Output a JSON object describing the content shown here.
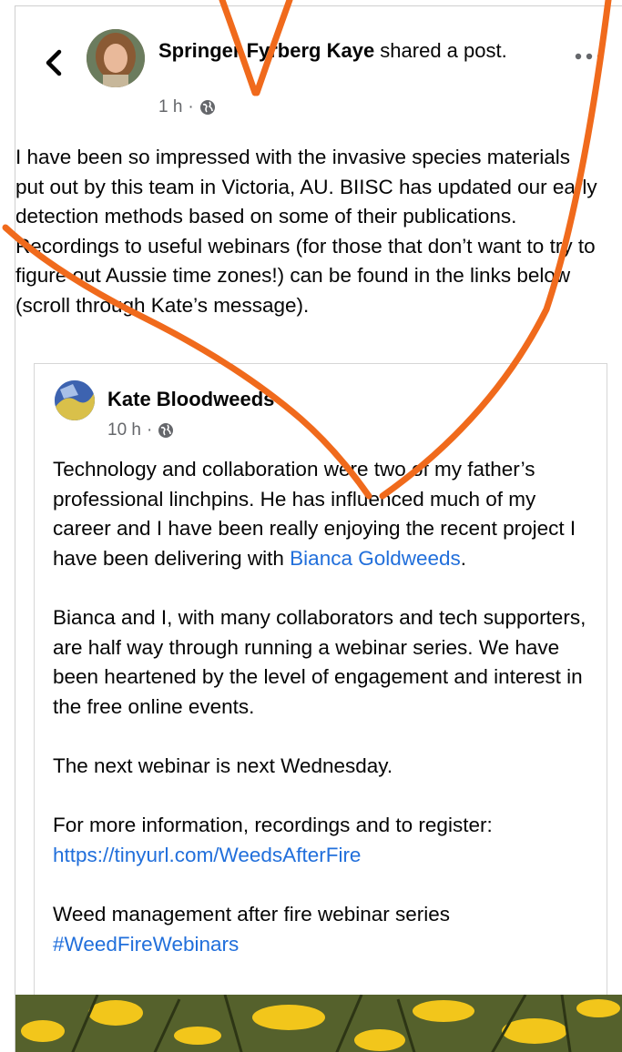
{
  "header": {
    "author": "Springer Fyrberg Kaye",
    "action": " shared a post.",
    "time": "1 h",
    "separator": "·"
  },
  "post": {
    "text": "I have been so impressed with the invasive species materials put out by this team in Victoria, AU. BIISC has updated our early detection methods based on some of their publications. Recordings to useful webinars (for those that don’t want to try to figure out Aussie time zones!) can be found in the links below (scroll through Kate’s message)."
  },
  "shared": {
    "author": "Kate Bloodweeds",
    "time": "10 h",
    "separator": "·",
    "p1_a": "Technology and collaboration were two of my father’s professional linchpins. He has influenced much of my career and I have been really enjoying the recent project I have been delivering with ",
    "p1_link": "Bianca Goldweeds",
    "p1_end": ".",
    "p2": "Bianca and I, with many collaborators and tech supporters, are half way through running a webinar series. We have been heartened by the level of engagement and interest in the free online events.",
    "p3": "The next webinar is next Wednesday.",
    "p4_a": "For more information, recordings and to register:",
    "p4_link": "https://tinyurl.com/WeedsAfterFire",
    "p5_a": "Weed management after fire webinar series",
    "p5_link": "#WeedFireWebinars"
  },
  "icons": {
    "back": "chevron-left-icon",
    "more": "more-horizontal-icon",
    "privacy": "globe-icon"
  },
  "colors": {
    "link": "#216fdb",
    "annotation": "#f06a1c",
    "meta": "#65676b"
  }
}
